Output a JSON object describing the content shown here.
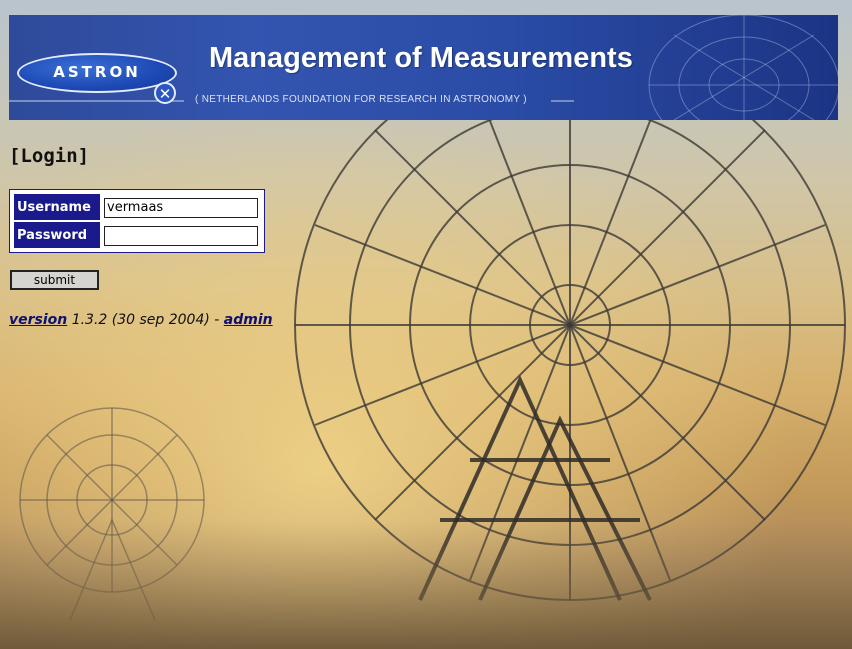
{
  "header": {
    "logo_text": "ASTRON",
    "title": "Management of Measurements",
    "subtitle": "( NETHERLANDS FOUNDATION FOR RESEARCH IN ASTRONOMY )"
  },
  "login": {
    "heading": "[Login]",
    "username_label": "Username",
    "username_value": "vermaas",
    "password_label": "Password",
    "password_value": "",
    "submit_label": "submit"
  },
  "footer": {
    "version_link": "version",
    "version_text": " 1.3.2 (30 sep 2004) - ",
    "admin_link": "admin"
  },
  "colors": {
    "banner": "#2e4a9a",
    "form_label_bg": "#1a1a8c",
    "link": "#101070"
  },
  "icons": {
    "logo_mark": "x-circle-icon"
  }
}
